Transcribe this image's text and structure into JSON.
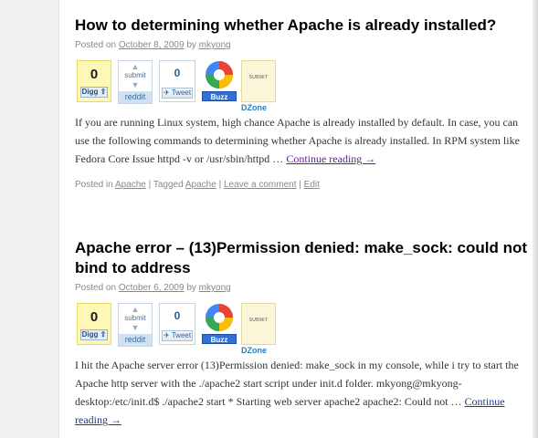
{
  "posts": [
    {
      "title": "How to determining whether Apache is already installed?",
      "meta": {
        "posted_on_label": "Posted on",
        "date": "October 8, 2009",
        "by_label": "by",
        "author": "mkyong"
      },
      "share": {
        "digg_count": "0",
        "digg_button": "Digg",
        "reddit_label": "submit",
        "reddit_band": "reddit",
        "tweet_count": "0",
        "tweet_button": "Tweet",
        "buzz_button": "Buzz",
        "dzone_submit": "SUBMIT",
        "dzone_name": "DZone"
      },
      "body_text": "If you are running Linux system, high chance Apache is already installed by default. In case, you can use the following commands to determining whether Apache is already installed. In RPM system like Fedora Core Issue httpd -v or /usr/sbin/httpd … ",
      "more_link": "Continue reading →",
      "footer": {
        "posted_in_label": "Posted in",
        "category": "Apache",
        "tagged_label": "| Tagged",
        "tag": "Apache",
        "sep1": "|",
        "comment_link": "Leave a comment",
        "sep2": "|",
        "edit_link": "Edit"
      }
    },
    {
      "title": "Apache error – (13)Permission denied: make_sock: could not bind to address",
      "meta": {
        "posted_on_label": "Posted on",
        "date": "October 6, 2009",
        "by_label": "by",
        "author": "mkyong"
      },
      "share": {
        "digg_count": "0",
        "digg_button": "Digg",
        "reddit_label": "submit",
        "reddit_band": "reddit",
        "tweet_count": "0",
        "tweet_button": "Tweet",
        "buzz_button": "Buzz",
        "dzone_submit": "SUBMIT",
        "dzone_name": "DZone"
      },
      "body_text": "I hit the Apache server error (13)Permission denied: make_sock in my console, while i try to start the Apache http server with the ./apache2 start script under init.d folder. mkyong@mkyong-desktop:/etc/init.d$ ./apache2 start * Starting web server apache2 apache2: Could not … ",
      "more_link": "Continue reading →"
    }
  ],
  "colors": {
    "title": "#000000",
    "meta": "#888888",
    "link": "#1a3a8f",
    "buzz_blue": "#2f6fd6",
    "digg_yellow": "#fff7b6"
  }
}
